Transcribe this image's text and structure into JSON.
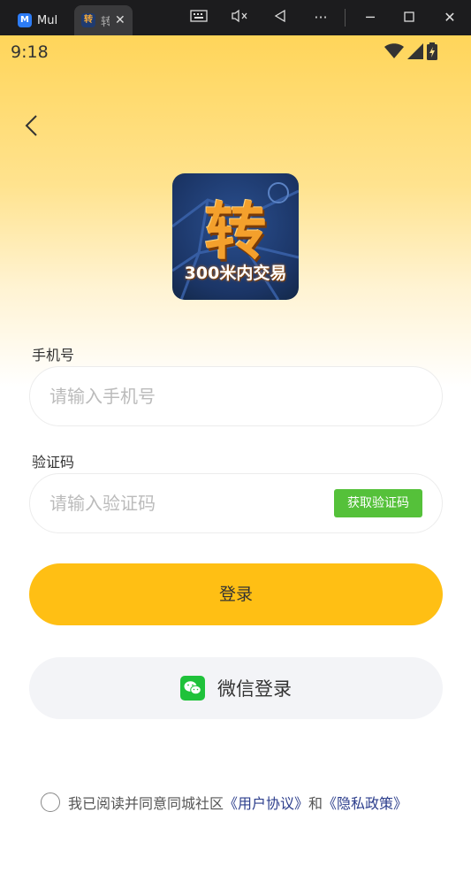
{
  "window": {
    "tabs": [
      {
        "label": "MuMu"
      },
      {
        "label": "转"
      }
    ]
  },
  "status": {
    "time": "9:18"
  },
  "logo": {
    "big": "转",
    "sub": "300米内交易"
  },
  "form": {
    "phone_label": "手机号",
    "phone_placeholder": "请输入手机号",
    "code_label": "验证码",
    "code_placeholder": "请输入验证码",
    "get_code_label": "获取验证码"
  },
  "buttons": {
    "login": "登录",
    "wechat_login": "微信登录"
  },
  "agreement": {
    "prefix": "我已阅读并同意同城社区",
    "user_agreement": "《用户协议》",
    "and": "和",
    "privacy_policy": "《隐私政策》"
  },
  "colors": {
    "primary": "#ffbf14",
    "code_button": "#55c13a",
    "wechat": "#1fc23a",
    "link": "#2c3e8c"
  }
}
